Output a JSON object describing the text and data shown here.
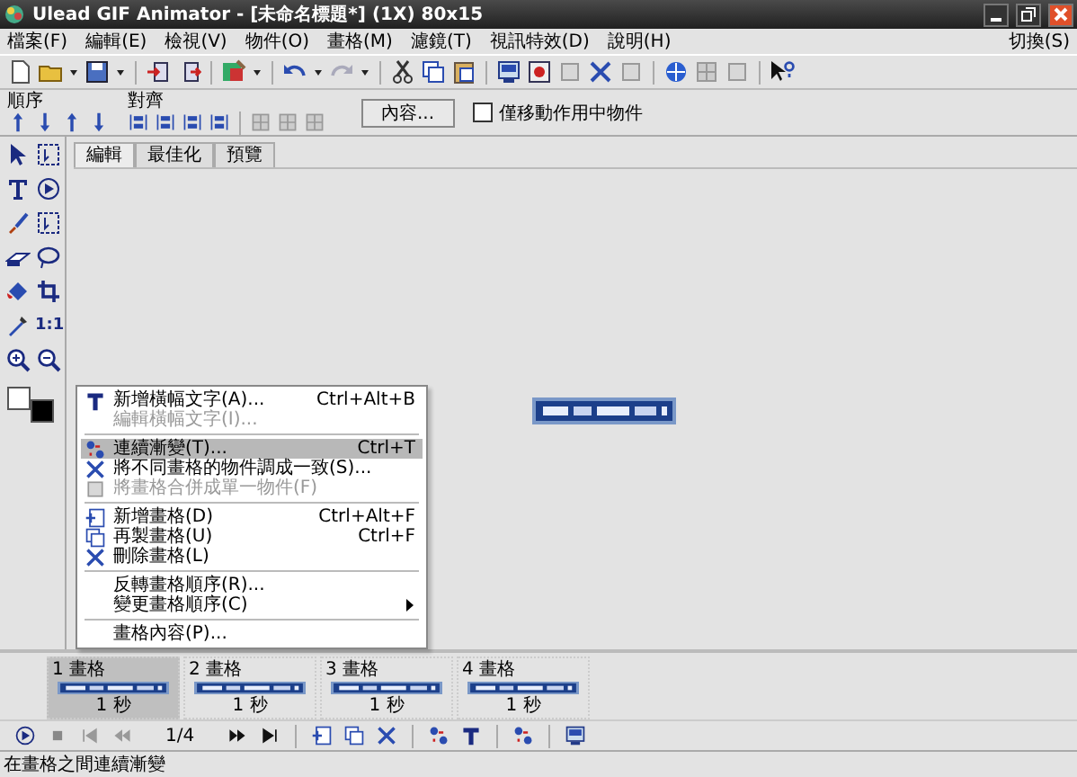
{
  "window": {
    "title": "Ulead GIF Animator - [未命名標題*] (1X) 80x15"
  },
  "menu_bar": {
    "items": [
      "檔案(F)",
      "編輯(E)",
      "檢視(V)",
      "物件(O)",
      "畫格(M)",
      "濾鏡(T)",
      "視訊特效(D)",
      "說明(H)"
    ],
    "right_item": "切換(S)"
  },
  "object_toolbar": {
    "order_label": "順序",
    "align_label": "對齊",
    "properties_button": "內容...",
    "move_active_only": {
      "label": "僅移動作用中物件",
      "checked": false
    }
  },
  "tool_panel": {
    "actual_size_label": "1:1"
  },
  "tabs": [
    {
      "label": "編輯",
      "selected": true
    },
    {
      "label": "最佳化",
      "selected": false
    },
    {
      "label": "預覽",
      "selected": false
    }
  ],
  "context_menu": [
    {
      "kind": "item",
      "label": "新增橫幅文字(A)...",
      "shortcut": "Ctrl+Alt+B",
      "disabled": false,
      "selected": false,
      "submenu": false
    },
    {
      "kind": "item",
      "label": "編輯橫幅文字(I)...",
      "disabled": true,
      "selected": false,
      "submenu": false
    },
    {
      "kind": "separator"
    },
    {
      "kind": "item",
      "label": "連續漸變(T)...",
      "shortcut": "Ctrl+T",
      "disabled": false,
      "selected": true,
      "submenu": false
    },
    {
      "kind": "item",
      "label": "將不同畫格的物件調成一致(S)...",
      "disabled": false,
      "selected": false,
      "submenu": false
    },
    {
      "kind": "item",
      "label": "將畫格合併成單一物件(F)",
      "disabled": true,
      "selected": false,
      "submenu": false
    },
    {
      "kind": "separator"
    },
    {
      "kind": "item",
      "label": "新增畫格(D)",
      "shortcut": "Ctrl+Alt+F",
      "disabled": false,
      "selected": false,
      "submenu": false
    },
    {
      "kind": "item",
      "label": "再製畫格(U)",
      "shortcut": "Ctrl+F",
      "disabled": false,
      "selected": false,
      "submenu": false
    },
    {
      "kind": "item",
      "label": "刪除畫格(L)",
      "disabled": false,
      "selected": false,
      "submenu": false
    },
    {
      "kind": "separator"
    },
    {
      "kind": "item",
      "label": "反轉畫格順序(R)...",
      "disabled": false,
      "selected": false,
      "submenu": false
    },
    {
      "kind": "item",
      "label": "變更畫格順序(C)",
      "disabled": false,
      "selected": false,
      "submenu": true
    },
    {
      "kind": "separator"
    },
    {
      "kind": "item",
      "label": "畫格內容(P)...",
      "disabled": false,
      "selected": false,
      "submenu": false
    }
  ],
  "frames": [
    {
      "label": "1 畫格",
      "duration": "1 秒",
      "selected": true
    },
    {
      "label": "2 畫格",
      "duration": "1 秒",
      "selected": false
    },
    {
      "label": "3 畫格",
      "duration": "1 秒",
      "selected": false
    },
    {
      "label": "4 畫格",
      "duration": "1 秒",
      "selected": false
    }
  ],
  "frame_toolbar": {
    "counter": "1/4"
  },
  "status_bar": {
    "text": "在畫格之間連續漸變"
  }
}
